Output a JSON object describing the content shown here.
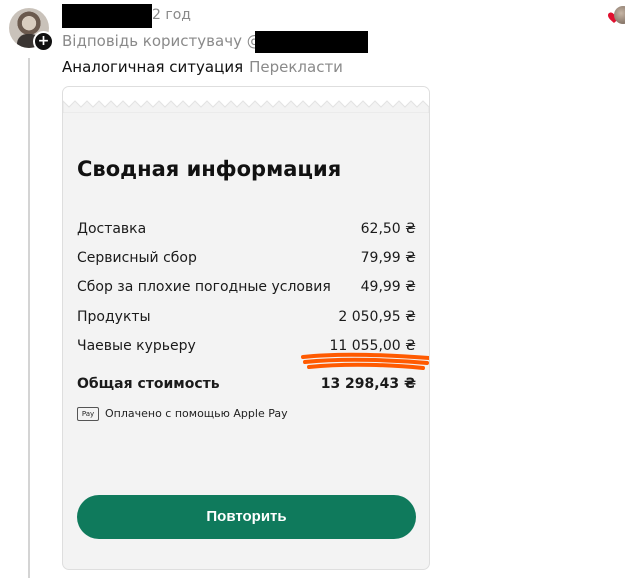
{
  "comment": {
    "time": "2 год",
    "reply_label": "Відповідь користувачу @",
    "text": "Аналогичная ситуация",
    "translate": "Перекласти"
  },
  "receipt": {
    "title": "Сводная информация",
    "rows": [
      {
        "label": "Доставка",
        "value": "62,50 ₴"
      },
      {
        "label": "Сервисный сбор",
        "value": "79,99 ₴"
      },
      {
        "label": "Сбор за плохие погодные условия",
        "value": "49,99 ₴"
      },
      {
        "label": "Продукты",
        "value": "2 050,95 ₴"
      },
      {
        "label": "Чаевые курьеру",
        "value": "11 055,00 ₴"
      }
    ],
    "total": {
      "label": "Общая стоимость",
      "value": "13 298,43 ₴"
    },
    "payment": {
      "badge": "Pay",
      "text": "Оплачено с помощью Apple Pay"
    },
    "button": "Повторить"
  },
  "colors": {
    "button": "#0f7a5c",
    "scribble": "#ff5a00",
    "heart": "#e0102f"
  },
  "icons": [
    "avatar",
    "plus-icon",
    "heart-icon",
    "apple-pay-icon"
  ]
}
